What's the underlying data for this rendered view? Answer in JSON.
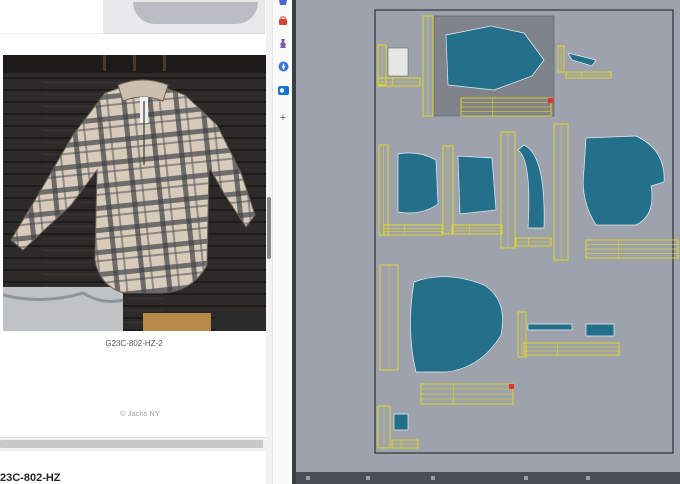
{
  "browser": {
    "product_photo_caption": "G23C-802-HZ-2",
    "brand_credit": "© Jachs NY",
    "product_heading": "23C-802-HZ"
  },
  "sidebar": {
    "icons": [
      "shopping-bag-icon",
      "toolbox-icon",
      "chess-piece-icon",
      "compass-icon",
      "outlook-icon",
      "plus-icon"
    ]
  },
  "cad": {
    "background": "#9da2ac",
    "piece_fill": "#24708a",
    "table_color": "#f3e300",
    "marker_color": "#e53030"
  }
}
